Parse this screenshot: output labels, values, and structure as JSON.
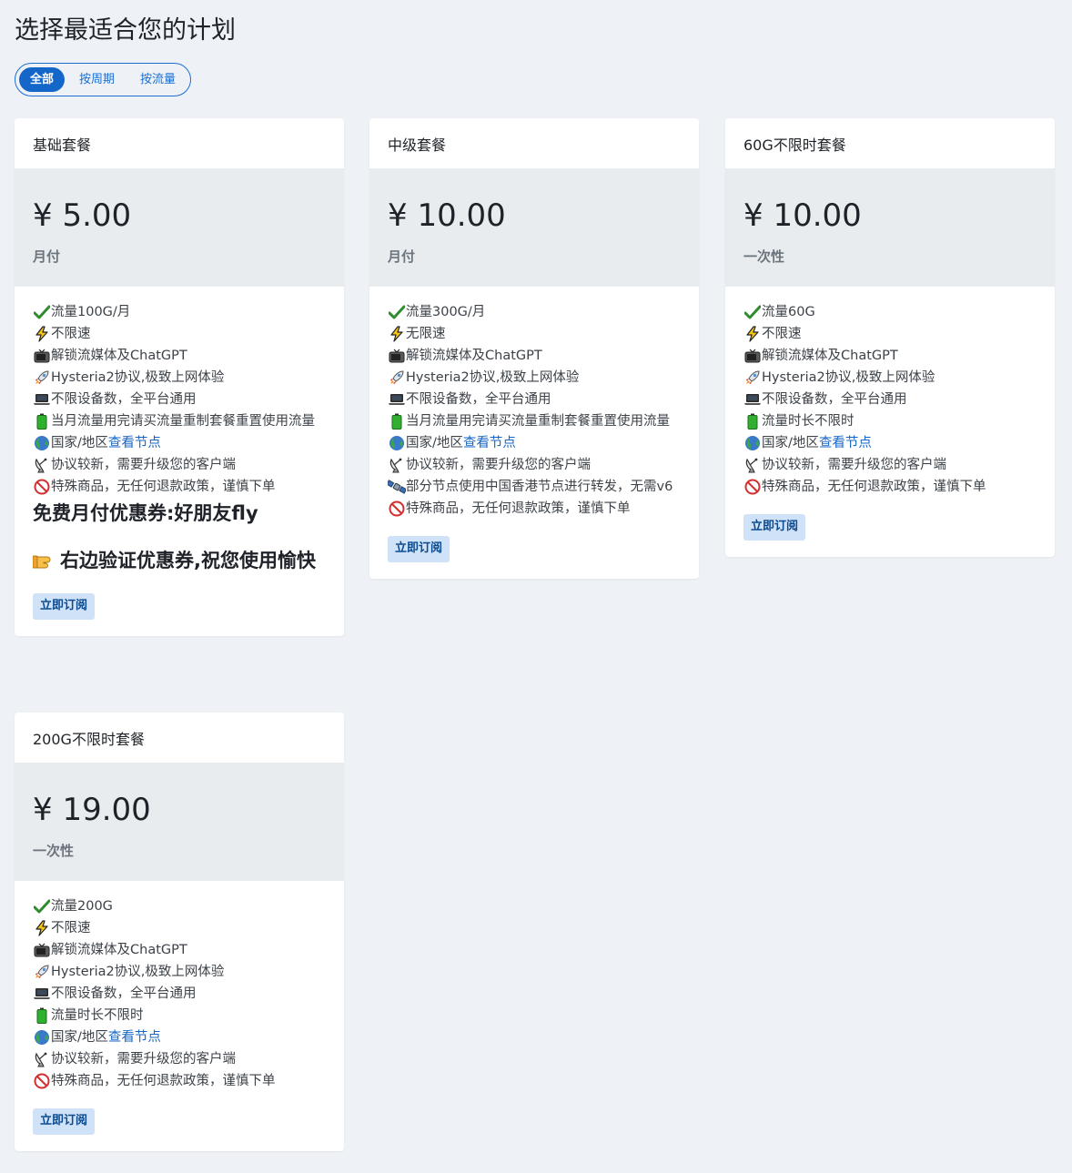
{
  "page": {
    "title": "选择最适合您的计划"
  },
  "filter": {
    "tabs": [
      {
        "label": "全部",
        "active": true
      },
      {
        "label": "按周期",
        "active": false
      },
      {
        "label": "按流量",
        "active": false
      }
    ]
  },
  "plans": [
    {
      "name": "基础套餐",
      "price": "¥ 5.00",
      "period": "月付",
      "features": [
        {
          "icon": "check-icon",
          "text": "流量100G/月"
        },
        {
          "icon": "lightning-icon",
          "text": "不限速"
        },
        {
          "icon": "tv-icon",
          "text": "解锁流媒体及ChatGPT"
        },
        {
          "icon": "rocket-icon",
          "text": "Hysteria2协议,极致上网体验"
        },
        {
          "icon": "laptop-icon",
          "text": "不限设备数，全平台通用"
        },
        {
          "icon": "battery-icon",
          "text": "当月流量用完请买流量重制套餐重置使用流量"
        },
        {
          "icon": "globe-icon",
          "text": "国家/地区",
          "link": "查看节点"
        },
        {
          "icon": "satellite-dish-icon",
          "text": "协议较新，需要升级您的客户端"
        },
        {
          "icon": "no-entry-icon",
          "text": " 特殊商品，无任何退款政策，谨慎下单"
        }
      ],
      "promo_1": "免费月付优惠券:好朋友fly",
      "promo_2": "右边验证优惠券,祝您使用愉快",
      "button": "立即订阅"
    },
    {
      "name": "中级套餐",
      "price": "¥ 10.00",
      "period": "月付",
      "features": [
        {
          "icon": "check-icon",
          "text": "流量300G/月"
        },
        {
          "icon": "lightning-icon",
          "text": "无限速"
        },
        {
          "icon": "tv-icon",
          "text": "解锁流媒体及ChatGPT"
        },
        {
          "icon": "rocket-icon",
          "text": "Hysteria2协议,极致上网体验"
        },
        {
          "icon": "laptop-icon",
          "text": "不限设备数，全平台通用"
        },
        {
          "icon": "battery-icon",
          "text": "当月流量用完请买流量重制套餐重置使用流量"
        },
        {
          "icon": "globe-icon",
          "text": "国家/地区",
          "link": "查看节点"
        },
        {
          "icon": "satellite-dish-icon",
          "text": "协议较新，需要升级您的客户端"
        },
        {
          "icon": "satellite-icon",
          "text": "部分节点使用中国香港节点进行转发，无需v6"
        },
        {
          "icon": "no-entry-icon",
          "text": " 特殊商品，无任何退款政策，谨慎下单"
        }
      ],
      "button": "立即订阅"
    },
    {
      "name": "60G不限时套餐",
      "price": "¥ 10.00",
      "period": "一次性",
      "features": [
        {
          "icon": "check-icon",
          "text": "流量60G"
        },
        {
          "icon": "lightning-icon",
          "text": "不限速"
        },
        {
          "icon": "tv-icon",
          "text": "解锁流媒体及ChatGPT"
        },
        {
          "icon": "rocket-icon",
          "text": "Hysteria2协议,极致上网体验"
        },
        {
          "icon": "laptop-icon",
          "text": "不限设备数，全平台通用"
        },
        {
          "icon": "battery-icon",
          "text": "流量时长不限时"
        },
        {
          "icon": "globe-icon",
          "text": "国家/地区",
          "link": "查看节点"
        },
        {
          "icon": "satellite-dish-icon",
          "text": "协议较新，需要升级您的客户端"
        },
        {
          "icon": "no-entry-icon",
          "text": " 特殊商品，无任何退款政策，谨慎下单"
        }
      ],
      "button": "立即订阅"
    },
    {
      "name": "200G不限时套餐",
      "price": "¥ 19.00",
      "period": "一次性",
      "features": [
        {
          "icon": "check-icon",
          "text": "流量200G"
        },
        {
          "icon": "lightning-icon",
          "text": "不限速"
        },
        {
          "icon": "tv-icon",
          "text": "解锁流媒体及ChatGPT"
        },
        {
          "icon": "rocket-icon",
          "text": "Hysteria2协议,极致上网体验"
        },
        {
          "icon": "laptop-icon",
          "text": "不限设备数，全平台通用"
        },
        {
          "icon": "battery-icon",
          "text": "流量时长不限时"
        },
        {
          "icon": "globe-icon",
          "text": "国家/地区",
          "link": "查看节点"
        },
        {
          "icon": "satellite-dish-icon",
          "text": "协议较新，需要升级您的客户端"
        },
        {
          "icon": "no-entry-icon",
          "text": " 特殊商品，无任何退款政策，谨慎下单"
        }
      ],
      "button": "立即订阅"
    }
  ]
}
